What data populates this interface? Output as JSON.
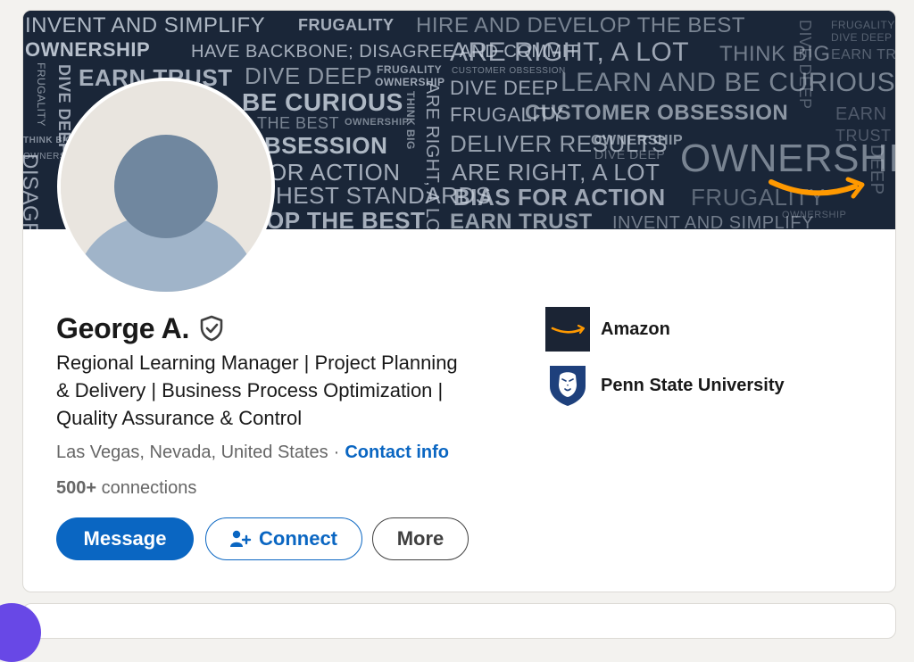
{
  "profile": {
    "name": "George A.",
    "headline_lines": [
      "Regional Learning Manager | Project Planning",
      "& Delivery | Business Process Optimization |",
      "Quality Assurance & Control"
    ],
    "location": "Las Vegas, Nevada, United States",
    "separator": "·",
    "contact_label": "Contact info",
    "connections_count": "500+",
    "connections_label": "connections",
    "verified_icon": "shield-check-icon"
  },
  "actions": {
    "message_label": "Message",
    "connect_label": "Connect",
    "more_label": "More"
  },
  "organizations": [
    {
      "name": "Amazon",
      "logo": "amazon-smile-logo"
    },
    {
      "name": "Penn State University",
      "logo": "nittany-lion-shield-logo"
    }
  ],
  "banner": {
    "words": [
      "INVENT AND SIMPLIFY",
      "FRUGALITY",
      "HIRE AND DEVELOP THE BEST",
      "OWNERSHIP",
      "HAVE BACKBONE; DISAGREE AND COMMIT",
      "ARE RIGHT, A LOT",
      "THINK BIG",
      "EARN TRUST",
      "DIVE DEEP",
      "FRUGALITY",
      "OWNERSHIP",
      "CUSTOMER OBSESSION",
      "DIVE DEEP",
      "LEARN AND BE CURIOUS",
      "BE CURIOUS",
      "FRUGALITY",
      "CUSTOMER OBSESSION",
      "EARN",
      "THE BEST",
      "OWNERSHIP",
      "TRUST",
      "BSESSION",
      "DELIVER RESULTS",
      "OWNERSHIP",
      "DIVE DEEP",
      "OR ACTION",
      "ARE RIGHT, A LOT",
      "OWNERSHIP",
      "HEST STANDARDS",
      "BIAS FOR ACTION",
      "FRUGALITY",
      "OP THE BEST",
      "EARN TRUST",
      "INVENT AND SIMPLIFY",
      "OWNERSHIP",
      "DIVE DEEP",
      "FRUGALITY",
      "THINK BIG",
      "ARE RIGHT, A LOT",
      "DISAGR",
      "FRUGALITY",
      "DIVE DEEP",
      "EARN TRUST",
      "DEEP",
      "OWNERS",
      "THINK BIG",
      "DIVE DEEP"
    ]
  },
  "colors": {
    "accent": "#0a66c2",
    "banner_bg": "#1a2638",
    "amazon_orange": "#ff9900",
    "psu_blue": "#1e407c"
  }
}
